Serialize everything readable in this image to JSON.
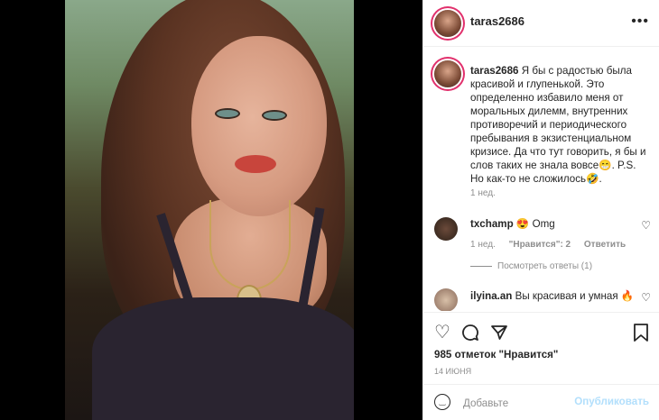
{
  "post": {
    "username": "taras2686",
    "more_icon": "more-dots-icon",
    "caption": {
      "username": "taras2686",
      "text": "Я бы с радостью была красивой и глупенькой. Это определенно избавило меня от моральных дилемм, внутренних противоречий и периодического пребывания в экзистенциальном кризисе. Да что тут говорить, я бы и слов таких не знала вовсе😁. P.S. Но как-то не сложилось🤣.",
      "time": "1 нед."
    },
    "comments": [
      {
        "username": "txchamp",
        "text": "😍 Omg",
        "time": "1 нед.",
        "likes": "\"Нравится\": 2",
        "reply": "Ответить",
        "view_replies": "Посмотреть ответы (1)"
      },
      {
        "username": "ilyina.an",
        "text": "Вы красивая и умная 🔥"
      }
    ],
    "likes": "985 отметок \"Нравится\"",
    "date": "14 июня",
    "add_comment": {
      "placeholder": "Добавьте",
      "publish_label": "Опубликовать"
    }
  }
}
